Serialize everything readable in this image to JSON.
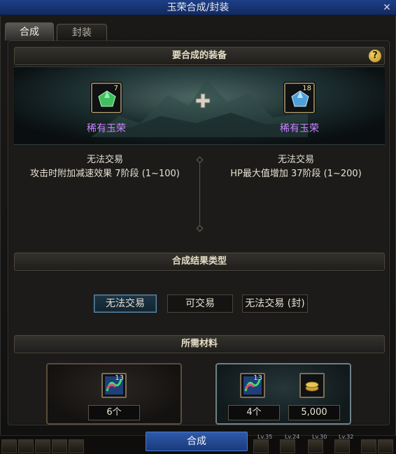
{
  "window": {
    "title": "玉荣合成/封装",
    "close": "✕"
  },
  "tabs": [
    {
      "label": "合成"
    },
    {
      "label": "封装"
    }
  ],
  "sections": {
    "equip": "要合成的装备",
    "result_type": "合成结果类型",
    "materials": "所需材料"
  },
  "help": "?",
  "items": [
    {
      "name": "稀有玉荣",
      "count": "7",
      "trade": "无法交易",
      "effect": "攻击时附加减速效果 7阶段 (1~100)"
    },
    {
      "name": "稀有玉荣",
      "count": "18",
      "trade": "无法交易",
      "effect": "HP最大值增加 37阶段 (1~200)"
    }
  ],
  "result_options": [
    {
      "label": "无法交易"
    },
    {
      "label": "可交易"
    },
    {
      "label": "无法交易 (封)"
    }
  ],
  "materials": {
    "left": {
      "slot_count": "13",
      "qty": "6个"
    },
    "right": {
      "slot_count": "13",
      "qty": "4个",
      "gold": "5,000"
    }
  },
  "craft_button": "合成",
  "hotbar_levels": [
    "Lv.35",
    "Lv.24",
    "Lv.30",
    "Lv.32"
  ],
  "colors": {
    "item_name": "#c884ff",
    "title_bar": "#1d3f86",
    "craft_button": "#2e5aa8"
  }
}
